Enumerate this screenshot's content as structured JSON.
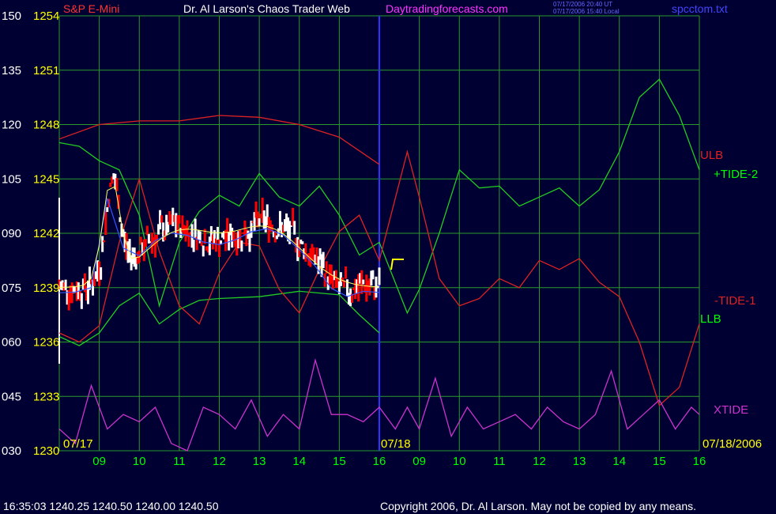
{
  "header": {
    "instrument": "S&P E-Mini",
    "site_title": "Dr. Al Larson's Chaos Trader Web",
    "site_url": "Daytradingforecasts.com",
    "timestamp_ut": "07/17/2006 20:40 UT",
    "timestamp_local": "07/17/2006 15:40 Local",
    "filename": "spcctom.txt"
  },
  "footer": {
    "quote": "16:35:03  1240.25 1240.50 1240.00 1240.50",
    "copyright": "Copyright 2006, Dr. Al Larson. May not be copied by any means."
  },
  "colors": {
    "background": "#000033",
    "grid": "#2a9a2a",
    "price_up": "#ffffff",
    "price_down": "#ff0000",
    "red_line": "#dd2222",
    "green_line": "#22cc22",
    "xtide": "#cc33cc",
    "axis_text": "#ffff00",
    "label_green": "#00ff00"
  },
  "chart_data": {
    "type": "line",
    "title": "S&P E-Mini",
    "left_axis_labels": [
      "150",
      "135",
      "120",
      "105",
      "090",
      "075",
      "060",
      "045",
      "030"
    ],
    "price_axis_labels": [
      "1254",
      "1251",
      "1248",
      "1245",
      "1242",
      "1239",
      "1236",
      "1233",
      "1230"
    ],
    "price_range": [
      1230,
      1254
    ],
    "x_ticks": [
      "09",
      "10",
      "11",
      "12",
      "13",
      "14",
      "15",
      "16",
      "09",
      "10",
      "11",
      "12",
      "13",
      "14",
      "15",
      "16"
    ],
    "date_labels": [
      "07/17",
      "07/18",
      "07/18/2006"
    ],
    "series_labels": [
      "ULB",
      "+TIDE-2",
      "-TIDE-1",
      "LLB",
      "XTIDE"
    ],
    "x_range_hours": [
      0,
      16
    ],
    "series": [
      {
        "name": "ULB",
        "color": "red",
        "x": [
          0,
          1,
          2,
          3,
          4,
          5,
          6,
          7,
          8
        ],
        "values": [
          1247.2,
          1248.0,
          1248.2,
          1248.2,
          1248.5,
          1248.4,
          1248.0,
          1247.3,
          1245.8
        ]
      },
      {
        "name": "LLB",
        "color": "green",
        "x": [
          0,
          0.5,
          1,
          1.5,
          2,
          2.5,
          3,
          3.5,
          4,
          5,
          6,
          7,
          7.5,
          8
        ],
        "values": [
          1236.3,
          1235.8,
          1236.5,
          1238.0,
          1238.7,
          1237.0,
          1237.8,
          1238.3,
          1238.4,
          1238.5,
          1238.8,
          1238.6,
          1237.5,
          1236.5
        ]
      },
      {
        "name": "+TIDE-2",
        "color": "green",
        "x": [
          0,
          0.5,
          1,
          1.5,
          2,
          2.5,
          3,
          3.5,
          4,
          4.5,
          5,
          5.5,
          6,
          6.5,
          7,
          7.5,
          8,
          8.7,
          9,
          9.5,
          10,
          10.5,
          11,
          11.5,
          12,
          12.5,
          13,
          13.5,
          14,
          14.5,
          15,
          15.5,
          16
        ],
        "values": [
          1247.0,
          1246.8,
          1246.0,
          1245.5,
          1243.0,
          1238.0,
          1241.5,
          1243.2,
          1244.1,
          1243.5,
          1245.3,
          1244.0,
          1243.5,
          1244.6,
          1243.0,
          1240.8,
          1241.5,
          1237.6,
          1238.9,
          1242.0,
          1245.5,
          1244.5,
          1244.6,
          1243.5,
          1244.0,
          1244.5,
          1243.5,
          1244.4,
          1246.5,
          1249.5,
          1250.5,
          1248.5,
          1245.5
        ]
      },
      {
        "name": "-TIDE-1",
        "color": "red",
        "x": [
          0,
          0.5,
          1,
          1.5,
          2,
          2.5,
          3,
          3.5,
          4,
          4.5,
          5,
          5.5,
          6,
          6.5,
          7,
          7.5,
          8,
          8.7,
          9,
          9.5,
          10,
          10.5,
          11,
          11.5,
          12,
          12.5,
          13,
          13.5,
          14,
          14.5,
          15,
          15.5,
          16
        ],
        "values": [
          1236.5,
          1236.0,
          1236.9,
          1241.5,
          1245.0,
          1241.0,
          1238.0,
          1237.0,
          1239.8,
          1241.5,
          1241.3,
          1238.9,
          1237.6,
          1240.0,
          1242.1,
          1243.0,
          1240.5,
          1246.5,
          1244.0,
          1239.5,
          1238.0,
          1238.4,
          1239.5,
          1239.0,
          1240.5,
          1240.0,
          1240.6,
          1239.3,
          1238.5,
          1236.0,
          1232.5,
          1233.5,
          1237.0
        ]
      },
      {
        "name": "XTIDE",
        "color": "magenta",
        "x": [
          0,
          0.4,
          0.8,
          1.2,
          1.6,
          2,
          2.4,
          2.8,
          3.2,
          3.6,
          4,
          4.4,
          4.8,
          5.2,
          5.6,
          6,
          6.4,
          6.8,
          7.2,
          7.6,
          8,
          8.4,
          8.7,
          9,
          9.4,
          9.8,
          10.2,
          10.6,
          11,
          11.4,
          11.8,
          12.2,
          12.6,
          13,
          13.4,
          13.8,
          14.2,
          14.6,
          15,
          15.4,
          15.8,
          16
        ],
        "values": [
          36,
          32,
          48,
          36,
          40,
          38,
          42,
          32,
          30,
          42,
          40,
          36,
          44,
          34,
          40,
          36,
          55,
          40,
          40,
          38,
          42,
          36,
          42,
          36,
          50,
          34,
          42,
          36,
          38,
          40,
          36,
          42,
          38,
          36,
          40,
          52,
          36,
          40,
          44,
          36,
          42,
          40
        ]
      }
    ]
  }
}
